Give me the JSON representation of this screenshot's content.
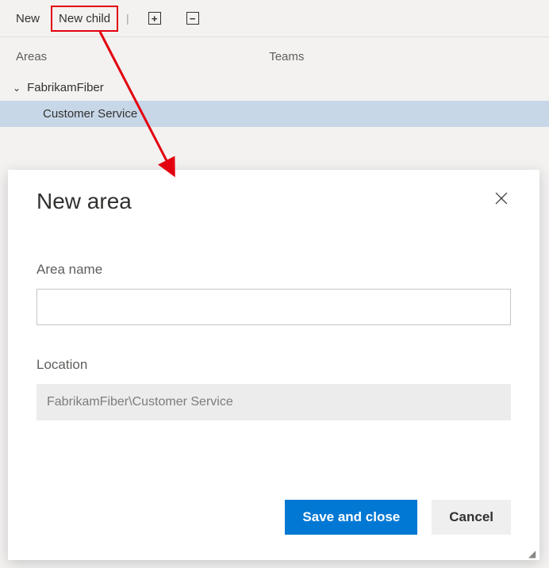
{
  "toolbar": {
    "new_label": "New",
    "new_child_label": "New child"
  },
  "tabs": {
    "areas": "Areas",
    "teams": "Teams"
  },
  "tree": {
    "root": "FabrikamFiber",
    "child": "Customer Service"
  },
  "dialog": {
    "title": "New area",
    "area_name_label": "Area name",
    "area_name_value": "",
    "location_label": "Location",
    "location_value": "FabrikamFiber\\Customer Service",
    "save_label": "Save and close",
    "cancel_label": "Cancel"
  }
}
